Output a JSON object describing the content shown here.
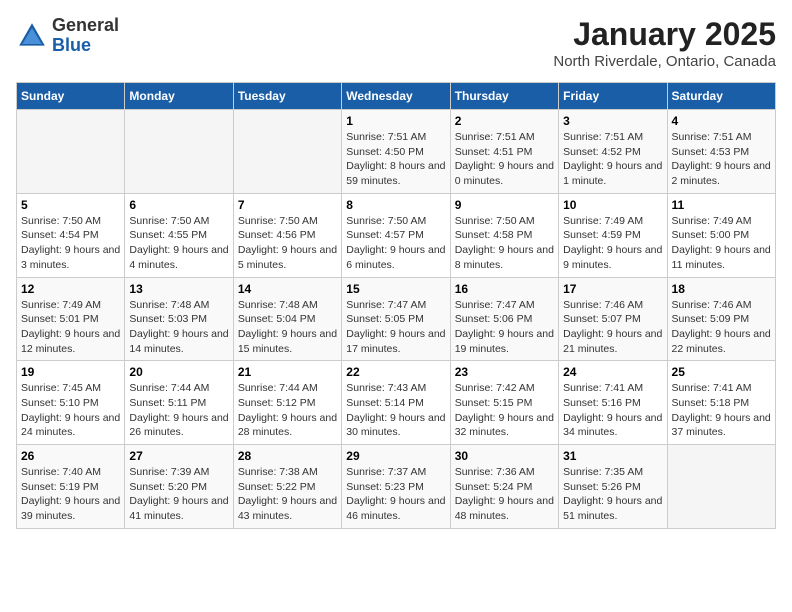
{
  "header": {
    "logo": {
      "text_general": "General",
      "text_blue": "Blue"
    },
    "title": "January 2025",
    "subtitle": "North Riverdale, Ontario, Canada"
  },
  "weekdays": [
    "Sunday",
    "Monday",
    "Tuesday",
    "Wednesday",
    "Thursday",
    "Friday",
    "Saturday"
  ],
  "weeks": [
    [
      {
        "day": "",
        "sunrise": "",
        "sunset": "",
        "daylight": "",
        "empty": true
      },
      {
        "day": "",
        "sunrise": "",
        "sunset": "",
        "daylight": "",
        "empty": true
      },
      {
        "day": "",
        "sunrise": "",
        "sunset": "",
        "daylight": "",
        "empty": true
      },
      {
        "day": "1",
        "sunrise": "Sunrise: 7:51 AM",
        "sunset": "Sunset: 4:50 PM",
        "daylight": "Daylight: 8 hours and 59 minutes.",
        "empty": false
      },
      {
        "day": "2",
        "sunrise": "Sunrise: 7:51 AM",
        "sunset": "Sunset: 4:51 PM",
        "daylight": "Daylight: 9 hours and 0 minutes.",
        "empty": false
      },
      {
        "day": "3",
        "sunrise": "Sunrise: 7:51 AM",
        "sunset": "Sunset: 4:52 PM",
        "daylight": "Daylight: 9 hours and 1 minute.",
        "empty": false
      },
      {
        "day": "4",
        "sunrise": "Sunrise: 7:51 AM",
        "sunset": "Sunset: 4:53 PM",
        "daylight": "Daylight: 9 hours and 2 minutes.",
        "empty": false
      }
    ],
    [
      {
        "day": "5",
        "sunrise": "Sunrise: 7:50 AM",
        "sunset": "Sunset: 4:54 PM",
        "daylight": "Daylight: 9 hours and 3 minutes.",
        "empty": false
      },
      {
        "day": "6",
        "sunrise": "Sunrise: 7:50 AM",
        "sunset": "Sunset: 4:55 PM",
        "daylight": "Daylight: 9 hours and 4 minutes.",
        "empty": false
      },
      {
        "day": "7",
        "sunrise": "Sunrise: 7:50 AM",
        "sunset": "Sunset: 4:56 PM",
        "daylight": "Daylight: 9 hours and 5 minutes.",
        "empty": false
      },
      {
        "day": "8",
        "sunrise": "Sunrise: 7:50 AM",
        "sunset": "Sunset: 4:57 PM",
        "daylight": "Daylight: 9 hours and 6 minutes.",
        "empty": false
      },
      {
        "day": "9",
        "sunrise": "Sunrise: 7:50 AM",
        "sunset": "Sunset: 4:58 PM",
        "daylight": "Daylight: 9 hours and 8 minutes.",
        "empty": false
      },
      {
        "day": "10",
        "sunrise": "Sunrise: 7:49 AM",
        "sunset": "Sunset: 4:59 PM",
        "daylight": "Daylight: 9 hours and 9 minutes.",
        "empty": false
      },
      {
        "day": "11",
        "sunrise": "Sunrise: 7:49 AM",
        "sunset": "Sunset: 5:00 PM",
        "daylight": "Daylight: 9 hours and 11 minutes.",
        "empty": false
      }
    ],
    [
      {
        "day": "12",
        "sunrise": "Sunrise: 7:49 AM",
        "sunset": "Sunset: 5:01 PM",
        "daylight": "Daylight: 9 hours and 12 minutes.",
        "empty": false
      },
      {
        "day": "13",
        "sunrise": "Sunrise: 7:48 AM",
        "sunset": "Sunset: 5:03 PM",
        "daylight": "Daylight: 9 hours and 14 minutes.",
        "empty": false
      },
      {
        "day": "14",
        "sunrise": "Sunrise: 7:48 AM",
        "sunset": "Sunset: 5:04 PM",
        "daylight": "Daylight: 9 hours and 15 minutes.",
        "empty": false
      },
      {
        "day": "15",
        "sunrise": "Sunrise: 7:47 AM",
        "sunset": "Sunset: 5:05 PM",
        "daylight": "Daylight: 9 hours and 17 minutes.",
        "empty": false
      },
      {
        "day": "16",
        "sunrise": "Sunrise: 7:47 AM",
        "sunset": "Sunset: 5:06 PM",
        "daylight": "Daylight: 9 hours and 19 minutes.",
        "empty": false
      },
      {
        "day": "17",
        "sunrise": "Sunrise: 7:46 AM",
        "sunset": "Sunset: 5:07 PM",
        "daylight": "Daylight: 9 hours and 21 minutes.",
        "empty": false
      },
      {
        "day": "18",
        "sunrise": "Sunrise: 7:46 AM",
        "sunset": "Sunset: 5:09 PM",
        "daylight": "Daylight: 9 hours and 22 minutes.",
        "empty": false
      }
    ],
    [
      {
        "day": "19",
        "sunrise": "Sunrise: 7:45 AM",
        "sunset": "Sunset: 5:10 PM",
        "daylight": "Daylight: 9 hours and 24 minutes.",
        "empty": false
      },
      {
        "day": "20",
        "sunrise": "Sunrise: 7:44 AM",
        "sunset": "Sunset: 5:11 PM",
        "daylight": "Daylight: 9 hours and 26 minutes.",
        "empty": false
      },
      {
        "day": "21",
        "sunrise": "Sunrise: 7:44 AM",
        "sunset": "Sunset: 5:12 PM",
        "daylight": "Daylight: 9 hours and 28 minutes.",
        "empty": false
      },
      {
        "day": "22",
        "sunrise": "Sunrise: 7:43 AM",
        "sunset": "Sunset: 5:14 PM",
        "daylight": "Daylight: 9 hours and 30 minutes.",
        "empty": false
      },
      {
        "day": "23",
        "sunrise": "Sunrise: 7:42 AM",
        "sunset": "Sunset: 5:15 PM",
        "daylight": "Daylight: 9 hours and 32 minutes.",
        "empty": false
      },
      {
        "day": "24",
        "sunrise": "Sunrise: 7:41 AM",
        "sunset": "Sunset: 5:16 PM",
        "daylight": "Daylight: 9 hours and 34 minutes.",
        "empty": false
      },
      {
        "day": "25",
        "sunrise": "Sunrise: 7:41 AM",
        "sunset": "Sunset: 5:18 PM",
        "daylight": "Daylight: 9 hours and 37 minutes.",
        "empty": false
      }
    ],
    [
      {
        "day": "26",
        "sunrise": "Sunrise: 7:40 AM",
        "sunset": "Sunset: 5:19 PM",
        "daylight": "Daylight: 9 hours and 39 minutes.",
        "empty": false
      },
      {
        "day": "27",
        "sunrise": "Sunrise: 7:39 AM",
        "sunset": "Sunset: 5:20 PM",
        "daylight": "Daylight: 9 hours and 41 minutes.",
        "empty": false
      },
      {
        "day": "28",
        "sunrise": "Sunrise: 7:38 AM",
        "sunset": "Sunset: 5:22 PM",
        "daylight": "Daylight: 9 hours and 43 minutes.",
        "empty": false
      },
      {
        "day": "29",
        "sunrise": "Sunrise: 7:37 AM",
        "sunset": "Sunset: 5:23 PM",
        "daylight": "Daylight: 9 hours and 46 minutes.",
        "empty": false
      },
      {
        "day": "30",
        "sunrise": "Sunrise: 7:36 AM",
        "sunset": "Sunset: 5:24 PM",
        "daylight": "Daylight: 9 hours and 48 minutes.",
        "empty": false
      },
      {
        "day": "31",
        "sunrise": "Sunrise: 7:35 AM",
        "sunset": "Sunset: 5:26 PM",
        "daylight": "Daylight: 9 hours and 51 minutes.",
        "empty": false
      },
      {
        "day": "",
        "sunrise": "",
        "sunset": "",
        "daylight": "",
        "empty": true
      }
    ]
  ]
}
